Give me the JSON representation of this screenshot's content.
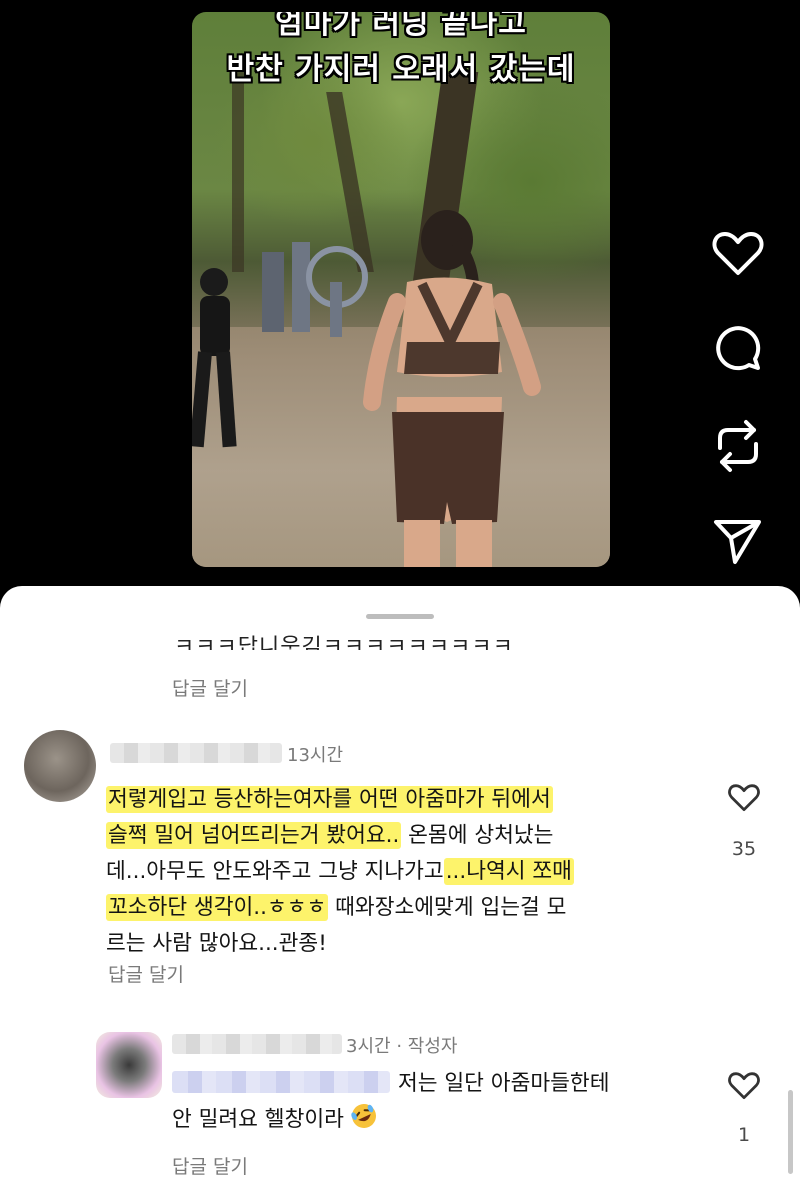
{
  "video": {
    "caption_line1": "엄마가 러닝 끝나고",
    "caption_line2": "반찬 가지러 오래서 갔는데"
  },
  "actions": {
    "like_icon": "heart-icon",
    "comment_icon": "comment-icon",
    "repost_icon": "repost-icon",
    "share_icon": "send-icon"
  },
  "comments_sheet": {
    "partial_text": "ㅋㅋㅋ답니웃김ㅋㅋㅋㅋㅋㅋㅋㅋㅋ",
    "partial_reply_label": "답글 달기",
    "comment1": {
      "time": "13시간",
      "text_hl1": "저렇게입고 등산하는여자를 어떤 아줌마가 뒤에서",
      "text_hl2": "슬쩍 밀어 넘어뜨리는거 봤어요..",
      "text_plain1": " 온몸에 상처났는",
      "text_plain2": "데...아무도 안도와주고 그냥 지나가고",
      "text_hl3": "...나역시 쪼매",
      "text_hl4": "꼬소하단 생각이..ㅎㅎㅎ",
      "text_plain3": " 때와장소에맞게 입는걸 모",
      "text_plain4": "르는 사람 많아요...관종!",
      "reply_label": "답글 달기",
      "likes": "35",
      "highlight_color": "#fdf36b"
    },
    "comment2": {
      "time": "3시간",
      "author_tag": "작성자",
      "separator": "·",
      "text1": "저는 일단 아줌마들한테",
      "text2": "안 밀려요 헬창이라",
      "emoji": "rolling-on-floor-laughing-emoji",
      "reply_label": "답글 달기",
      "likes": "1"
    }
  }
}
